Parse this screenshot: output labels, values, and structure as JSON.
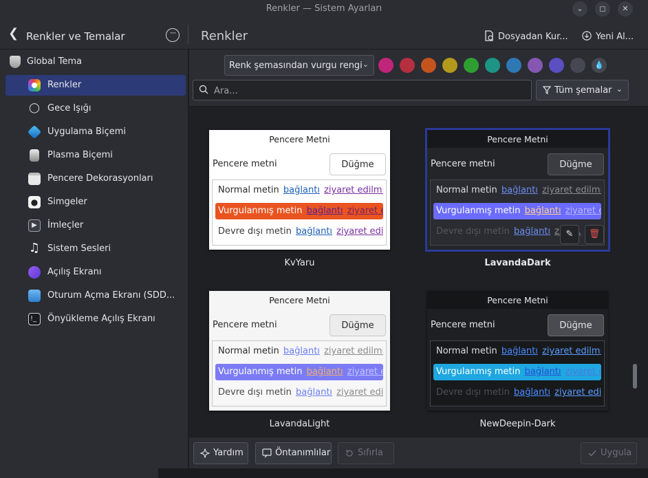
{
  "window": {
    "title": "Renkler — Sistem Ayarları"
  },
  "header": {
    "back_label": "Renkler ve Temalar",
    "page_title": "Renkler",
    "actions": [
      {
        "label": "Dosyadan Kur...",
        "icon": "file-install-icon"
      },
      {
        "label": "Yeni Al...",
        "icon": "download-icon"
      }
    ]
  },
  "sidebar": {
    "items": [
      {
        "label": "Global Tema",
        "icon": "global-theme-icon"
      },
      {
        "label": "Renkler",
        "icon": "colors-icon",
        "active": true
      },
      {
        "label": "Gece Işığı",
        "icon": "lightbulb-icon"
      },
      {
        "label": "Uygulama Biçemi",
        "icon": "app-style-icon"
      },
      {
        "label": "Plasma Biçemi",
        "icon": "plasma-style-icon"
      },
      {
        "label": "Pencere Dekorasyonları",
        "icon": "window-decoration-icon"
      },
      {
        "label": "Simgeler",
        "icon": "icons-icon"
      },
      {
        "label": "İmleçler",
        "icon": "cursor-icon"
      },
      {
        "label": "Sistem Sesleri",
        "icon": "music-note-icon"
      },
      {
        "label": "Açılış Ekranı",
        "icon": "splash-screen-icon"
      },
      {
        "label": "Oturum Açma Ekranı (SDD...",
        "icon": "login-screen-icon"
      },
      {
        "label": "Önyükleme Açılış Ekranı",
        "icon": "boot-splash-icon"
      }
    ]
  },
  "accent": {
    "select_value": "Renk şemasından vurgu rengi",
    "swatches": [
      "#c0257a",
      "#b52f3f",
      "#c4541e",
      "#b39a1c",
      "#2f9e32",
      "#1d9484",
      "#2e78b3",
      "#8457b3",
      "#5b4fc2",
      "#454850"
    ]
  },
  "search": {
    "placeholder": "Ara...",
    "filter_label": "Tüm şemalar"
  },
  "schemes": [
    {
      "name": "KvYaru",
      "title": "Pencere Metni",
      "window_text": "Pencere metni",
      "button": "Düğme",
      "rows": [
        {
          "label": "Normal metin",
          "link": "bağlantı",
          "visited": "ziyaret edilmiş"
        },
        {
          "label": "Vurgulanmış metin",
          "link": "bağlantı",
          "visited": "ziyaret e..."
        },
        {
          "label": "Devre dışı metin",
          "link": "bağlantı",
          "visited": "ziyaret edil..."
        }
      ]
    },
    {
      "name": "LavandaDark",
      "title": "Pencere Metni",
      "window_text": "Pencere metni",
      "button": "Düğme",
      "rows": [
        {
          "label": "Normal metin",
          "link": "bağlantı",
          "visited": "ziyaret edilmiş"
        },
        {
          "label": "Vurgulanmış metin",
          "link": "bağlantı",
          "visited": "ziyaret e..."
        },
        {
          "label": "Devre dışı metin",
          "link": "bağlantı",
          "visited": "ziya..."
        }
      ]
    },
    {
      "name": "LavandaLight",
      "title": "Pencere Metni",
      "window_text": "Pencere metni",
      "button": "Düğme",
      "rows": [
        {
          "label": "Normal metin",
          "link": "bağlantı",
          "visited": "ziyaret edilmiş"
        },
        {
          "label": "Vurgulanmış metin",
          "link": "bağlantı",
          "visited": "ziyaret e..."
        },
        {
          "label": "Devre dışı metin",
          "link": "bağlantı",
          "visited": "ziyaret edil..."
        }
      ]
    },
    {
      "name": "NewDeepin-Dark",
      "title": "Pencere Metni",
      "window_text": "Pencere metni",
      "button": "Düğme",
      "rows": [
        {
          "label": "Normal metin",
          "link": "bağlantı",
          "visited": "ziyaret edilmiş"
        },
        {
          "label": "Vurgulanmış metin",
          "link": "bağlantı",
          "visited": "ziyaret e..."
        },
        {
          "label": "Devre dışı metin",
          "link": "bağlantı",
          "visited": "ziyaret edil..."
        }
      ]
    }
  ],
  "footer": {
    "help": "Yardım",
    "defaults": "Öntanımlılar",
    "reset": "Sıfırla",
    "apply": "Uygula"
  }
}
